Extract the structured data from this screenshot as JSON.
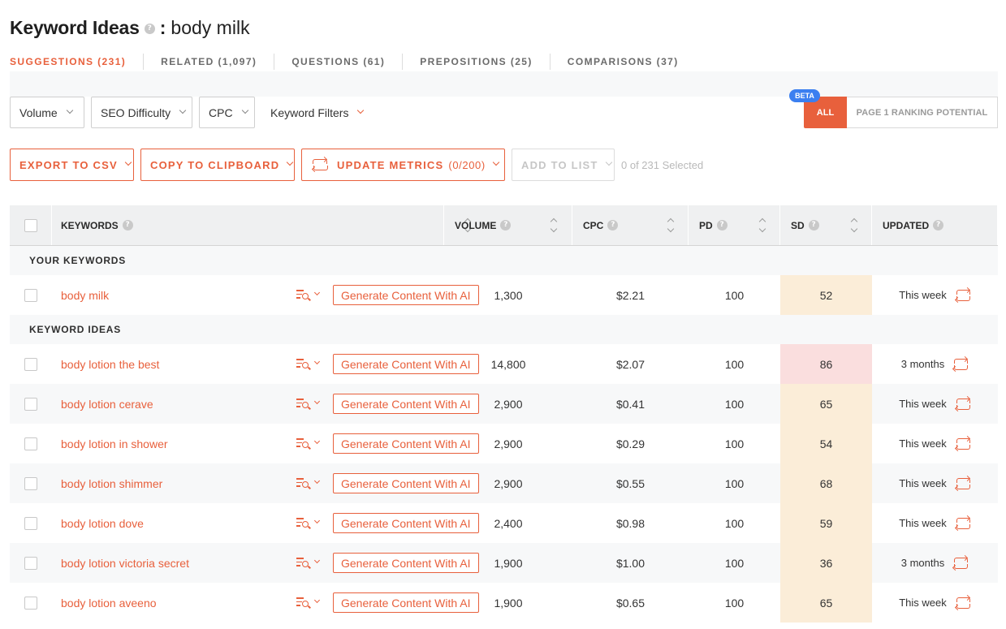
{
  "header": {
    "title": "Keyword Ideas",
    "separator": ":",
    "keyword": "body milk"
  },
  "tabs": [
    {
      "label": "SUGGESTIONS (231)",
      "active": true
    },
    {
      "label": "RELATED (1,097)",
      "active": false
    },
    {
      "label": "QUESTIONS (61)",
      "active": false
    },
    {
      "label": "PREPOSITIONS (25)",
      "active": false
    },
    {
      "label": "COMPARISONS (37)",
      "active": false
    }
  ],
  "filters": {
    "volume": "Volume",
    "seo_difficulty": "SEO Difficulty",
    "cpc": "CPC",
    "keyword_filters": "Keyword Filters"
  },
  "view_toggle": {
    "beta": "BETA",
    "all": "ALL",
    "page1": "PAGE 1 RANKING POTENTIAL"
  },
  "actions": {
    "export": "EXPORT TO CSV",
    "copy": "COPY TO CLIPBOARD",
    "update": "UPDATE METRICS",
    "update_count": "(0/200)",
    "add_to_list": "ADD TO LIST",
    "selected": "0 of 231 Selected"
  },
  "columns": {
    "keywords": "KEYWORDS",
    "volume": "VOLUME",
    "cpc": "CPC",
    "pd": "PD",
    "sd": "SD",
    "updated": "UPDATED"
  },
  "sections": {
    "your_keywords": "YOUR KEYWORDS",
    "keyword_ideas": "KEYWORD IDEAS"
  },
  "generate_label": "Generate Content With AI",
  "your_keywords": [
    {
      "keyword": "body milk",
      "volume": "1,300",
      "cpc": "$2.21",
      "pd": "100",
      "sd": "52",
      "updated": "This week",
      "sd_level": "mid"
    }
  ],
  "keyword_ideas": [
    {
      "keyword": "body lotion the best",
      "volume": "14,800",
      "cpc": "$2.07",
      "pd": "100",
      "sd": "86",
      "updated": "3 months",
      "sd_level": "high"
    },
    {
      "keyword": "body lotion cerave",
      "volume": "2,900",
      "cpc": "$0.41",
      "pd": "100",
      "sd": "65",
      "updated": "This week",
      "sd_level": "mid"
    },
    {
      "keyword": "body lotion in shower",
      "volume": "2,900",
      "cpc": "$0.29",
      "pd": "100",
      "sd": "54",
      "updated": "This week",
      "sd_level": "mid"
    },
    {
      "keyword": "body lotion shimmer",
      "volume": "2,900",
      "cpc": "$0.55",
      "pd": "100",
      "sd": "68",
      "updated": "This week",
      "sd_level": "mid"
    },
    {
      "keyword": "body lotion dove",
      "volume": "2,400",
      "cpc": "$0.98",
      "pd": "100",
      "sd": "59",
      "updated": "This week",
      "sd_level": "mid"
    },
    {
      "keyword": "body lotion victoria secret",
      "volume": "1,900",
      "cpc": "$1.00",
      "pd": "100",
      "sd": "36",
      "updated": "3 months",
      "sd_level": "mid"
    },
    {
      "keyword": "body lotion aveeno",
      "volume": "1,900",
      "cpc": "$0.65",
      "pd": "100",
      "sd": "65",
      "updated": "This week",
      "sd_level": "mid"
    }
  ],
  "colors": {
    "accent": "#e8603c",
    "beta": "#3b7ff0",
    "sd_mid": "#fbedd8",
    "sd_high": "#fadede"
  }
}
